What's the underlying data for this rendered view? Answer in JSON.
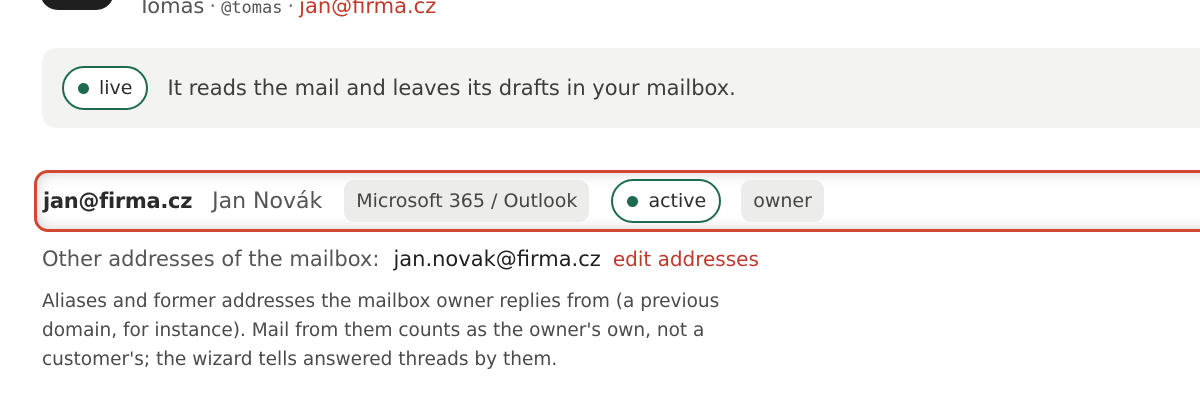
{
  "user": {
    "name": "Tomas",
    "handle": "@tomas",
    "separator": "·",
    "email": "jan@firma.cz"
  },
  "status_banner": {
    "pill_label": "live",
    "text": "It reads the mail and leaves its drafts in your mailbox."
  },
  "mailbox": {
    "address": "jan@firma.cz",
    "owner_name": "Jan Novák",
    "provider": "Microsoft 365 / Outlook",
    "status": "active",
    "role": "owner"
  },
  "other_addresses": {
    "label": "Other addresses of the mailbox:",
    "values": "jan.novak@firma.cz",
    "edit_link": "edit addresses"
  },
  "help_text": "Aliases and former addresses the mailbox owner replies from (a previous domain, for instance). Mail from them counts as the owner's own, not a customer's; the wizard tells answered threads by them.",
  "colors": {
    "accent_green": "#1d6b4f",
    "accent_red": "#c0392b",
    "highlight_border": "#d2472f"
  }
}
